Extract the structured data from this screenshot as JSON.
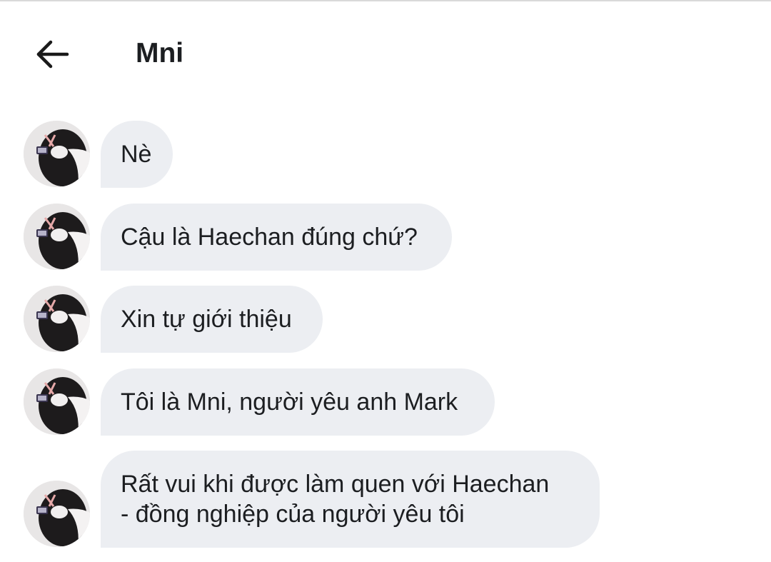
{
  "header": {
    "title": "Mni",
    "back_icon": "arrow-left-icon"
  },
  "messages": [
    {
      "sender": "Mni",
      "text": "Nè"
    },
    {
      "sender": "Mni",
      "text": "Cậu là Haechan đúng chứ?"
    },
    {
      "sender": "Mni",
      "text": "Xin tự giới thiệu"
    },
    {
      "sender": "Mni",
      "text": "Tôi là Mni, người yêu anh Mark"
    },
    {
      "sender": "Mni",
      "text": "Rất vui khi được làm quen với Haechan\n- đồng nghiệp của người yêu tôi"
    }
  ],
  "colors": {
    "bubble_background": "#eceef2",
    "text": "#1c1e21",
    "background": "#ffffff"
  }
}
